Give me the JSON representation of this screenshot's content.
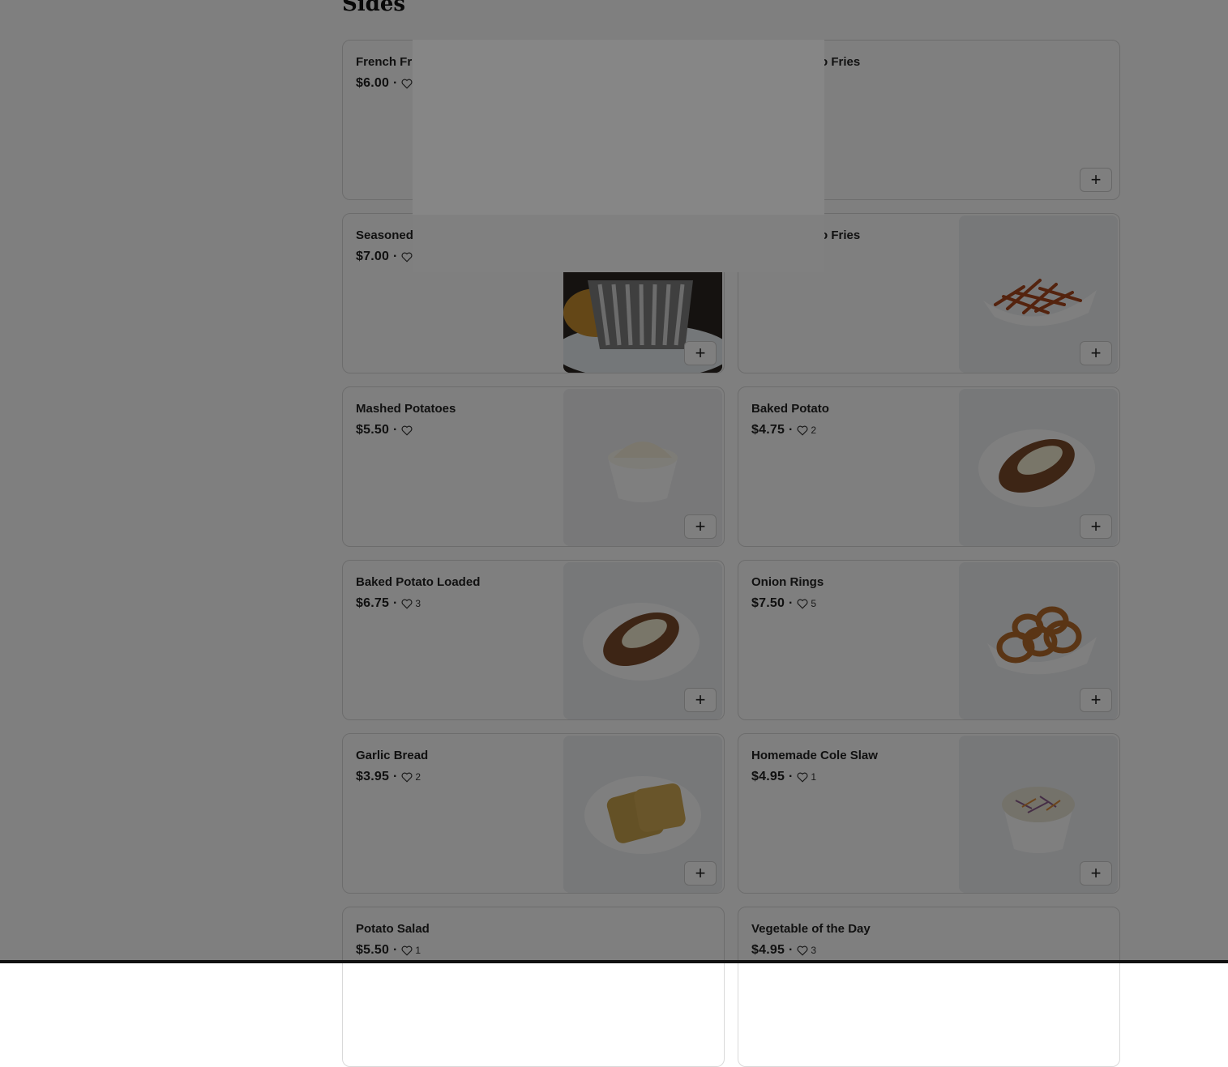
{
  "section": {
    "title": "Sides"
  },
  "items": [
    {
      "name": "French Fries",
      "price": "$6.00",
      "likes": "",
      "image": "none"
    },
    {
      "name": "Sweet Potato Fries",
      "price": "",
      "likes": "",
      "image": "none"
    },
    {
      "name": "Seasoned Fries",
      "price": "$7.00",
      "likes": "",
      "image": "basket-fries"
    },
    {
      "name": "Sweet Potato Fries",
      "price": "",
      "likes": "",
      "image": "sweet-fries"
    },
    {
      "name": "Mashed Potatoes",
      "price": "$5.50",
      "likes": "",
      "image": "mashed"
    },
    {
      "name": "Baked Potato",
      "price": "$4.75",
      "likes": "2",
      "image": "baked"
    },
    {
      "name": "Baked Potato Loaded",
      "price": "$6.75",
      "likes": "3",
      "image": "baked"
    },
    {
      "name": "Onion Rings",
      "price": "$7.50",
      "likes": "5",
      "image": "rings"
    },
    {
      "name": "Garlic Bread",
      "price": "$3.95",
      "likes": "2",
      "image": "bread"
    },
    {
      "name": "Homemade Cole Slaw",
      "price": "$4.95",
      "likes": "1",
      "image": "slaw"
    },
    {
      "name": "Potato Salad",
      "price": "$5.50",
      "likes": "1",
      "image": "none"
    },
    {
      "name": "Vegetable of the Day",
      "price": "$4.95",
      "likes": "3",
      "image": "none"
    }
  ],
  "add_button": {
    "label": "+"
  },
  "icons": {
    "like": "heart-icon",
    "add": "plus-icon"
  },
  "colors": {
    "overlay": "#000000",
    "card_border": "#d9d9d9"
  }
}
